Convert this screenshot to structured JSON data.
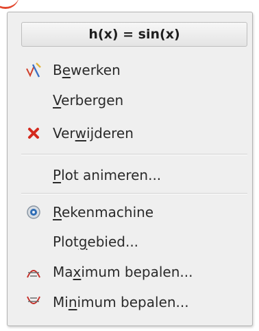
{
  "menu": {
    "title": "h(x) = sin(x)",
    "items": [
      {
        "id": "edit",
        "pre": "B",
        "u": "e",
        "post": "werken",
        "icon": "edit-plot-icon"
      },
      {
        "id": "hide",
        "pre": "",
        "u": "V",
        "post": "erbergen",
        "icon": ""
      },
      {
        "id": "delete",
        "pre": "Ver",
        "u": "w",
        "post": "ijderen",
        "icon": "delete-icon"
      },
      {
        "id": "animate",
        "pre": "",
        "u": "P",
        "post": "lot animeren...",
        "icon": ""
      },
      {
        "id": "calculator",
        "pre": "",
        "u": "R",
        "post": "ekenmachine",
        "icon": "calculator-icon"
      },
      {
        "id": "plot-area",
        "pre": "Plot",
        "u": "g",
        "post": "ebied...",
        "icon": ""
      },
      {
        "id": "maximum",
        "pre": "Ma",
        "u": "x",
        "post": "imum bepalen...",
        "icon": "maximum-icon"
      },
      {
        "id": "minimum",
        "pre": "Mi",
        "u": "n",
        "post": "imum bepalen...",
        "icon": "minimum-icon"
      }
    ]
  },
  "colors": {
    "delete": "#d42a1e",
    "maximum": "#c5302a",
    "calculator": "#2f6db5"
  }
}
